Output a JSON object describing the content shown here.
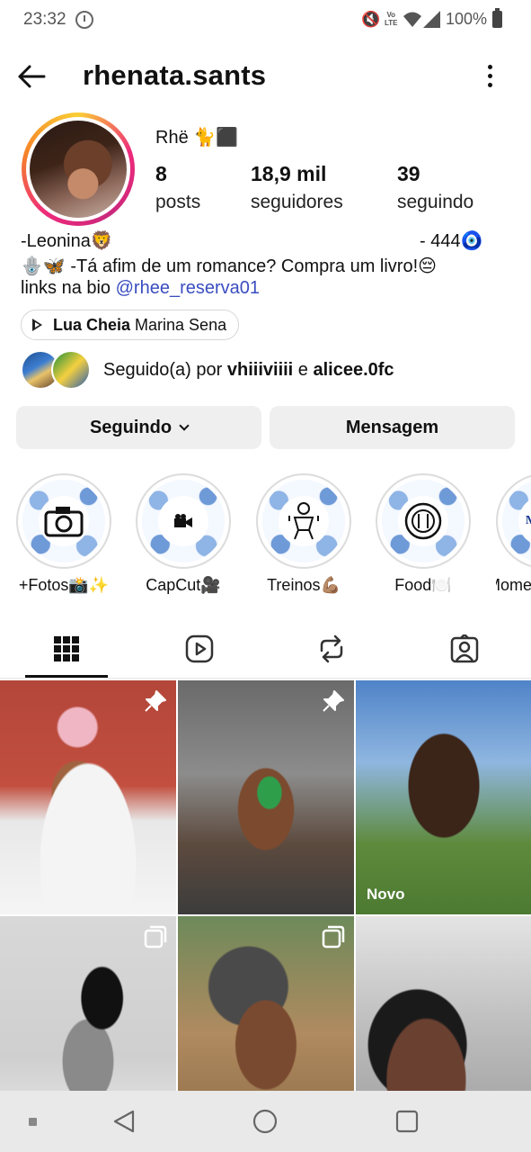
{
  "status_bar": {
    "time": "23:32",
    "battery": "100%",
    "volte": "Vo LTE"
  },
  "header": {
    "username": "rhenata.sants"
  },
  "profile": {
    "display_name": "Rhë 🐈⬛",
    "stats": [
      {
        "value": "8",
        "label": "posts"
      },
      {
        "value": "18,9 mil",
        "label": "seguidores"
      },
      {
        "value": "39",
        "label": "seguindo"
      }
    ],
    "bio": {
      "line1_left": "-Leonina🦁",
      "line1_right": "- 444🧿",
      "line2": "🪬🦋  -Tá afim de um romance? Compra um livro!😔",
      "line3_prefix": "links na bio ",
      "line3_link": "@rhee_reserva01"
    },
    "music": {
      "song": "Lua Cheia",
      "artist": "Marina Sena"
    },
    "followed_by": {
      "prefix": "Seguido(a) por ",
      "user1": "vhiiiviiii",
      "joiner": " e ",
      "user2": "alicee.0fc"
    }
  },
  "buttons": {
    "following": "Seguindo",
    "message": "Mensagem"
  },
  "highlights": [
    {
      "label": "+Fotos📸✨",
      "icon": "camera-icon"
    },
    {
      "label": "CapCut🎥",
      "icon": "video-camera-icon"
    },
    {
      "label": "Treinos💪🏽",
      "icon": "workout-icon"
    },
    {
      "label": "Food🍽️",
      "icon": "plate-icon"
    },
    {
      "label": "Mome",
      "icon": "moments-text",
      "cover_text": "Mo"
    }
  ],
  "tabs": [
    "grid-icon",
    "reels-icon",
    "reposts-icon",
    "tagged-icon"
  ],
  "grid": [
    {
      "badge": "pin-icon"
    },
    {
      "badge": "pin-icon"
    },
    {
      "label": "Novo"
    },
    {
      "badge": "carousel-icon"
    },
    {
      "badge": "carousel-icon"
    },
    {}
  ],
  "colors": {
    "link": "#3a4dc0",
    "button_bg": "#efefef"
  }
}
